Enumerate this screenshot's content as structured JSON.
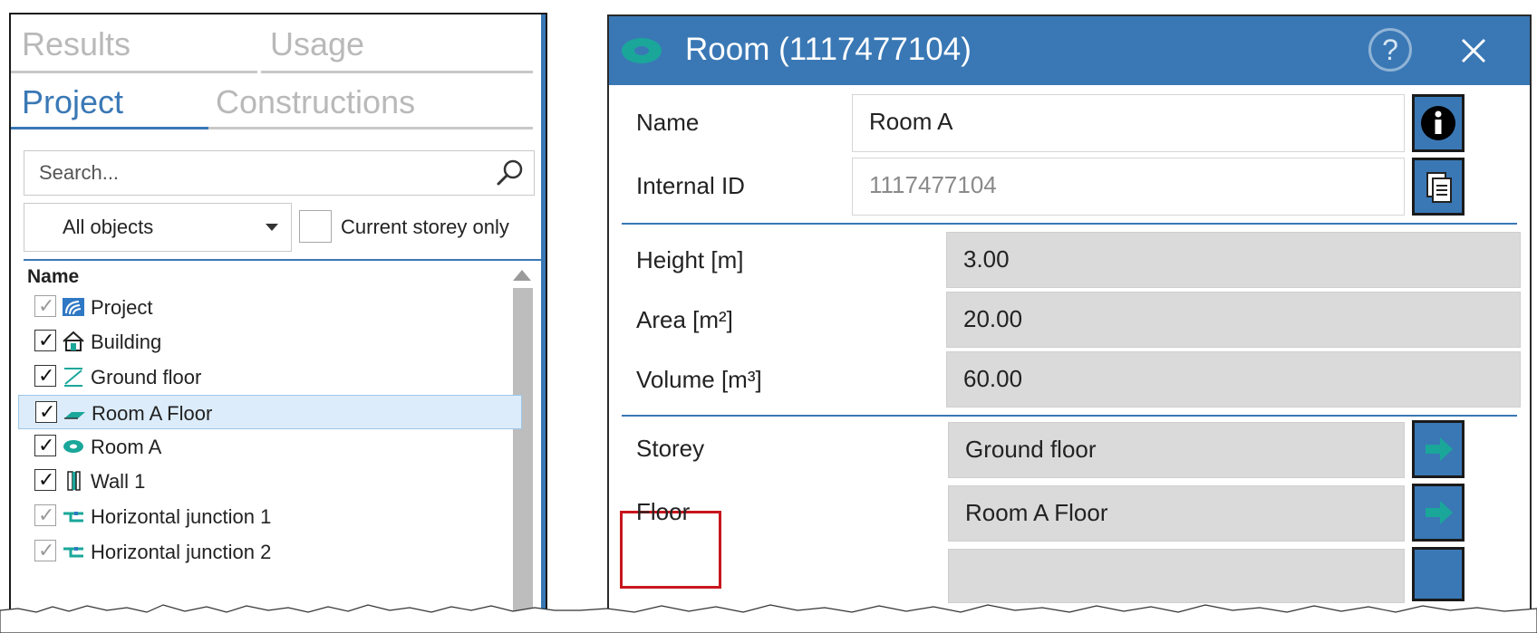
{
  "left_panel": {
    "tabs": {
      "results": "Results",
      "usage": "Usage",
      "project": "Project",
      "constructions": "Constructions"
    },
    "search": {
      "placeholder": "Search..."
    },
    "filter": {
      "selected": "All objects"
    },
    "storey_only_label": "Current storey only",
    "column_header": "Name",
    "tree": [
      {
        "label": "Project",
        "checked": true,
        "disabled": true,
        "icon": "project-icon"
      },
      {
        "label": "Building",
        "checked": true,
        "disabled": false,
        "icon": "building-icon"
      },
      {
        "label": "Ground floor",
        "checked": true,
        "disabled": false,
        "icon": "storey-icon"
      },
      {
        "label": "Room A Floor",
        "checked": true,
        "disabled": false,
        "icon": "floor-icon",
        "selected": true
      },
      {
        "label": "Room A",
        "checked": true,
        "disabled": false,
        "icon": "room-icon"
      },
      {
        "label": "Wall 1",
        "checked": true,
        "disabled": false,
        "icon": "wall-icon"
      },
      {
        "label": "Horizontal junction 1",
        "checked": true,
        "disabled": true,
        "icon": "junction-icon"
      },
      {
        "label": "Horizontal junction 2",
        "checked": true,
        "disabled": true,
        "icon": "junction-icon"
      }
    ]
  },
  "dialog": {
    "title": "Room (1117477104)",
    "help_symbol": "?",
    "fields": {
      "name": {
        "label": "Name",
        "value": "Room A"
      },
      "internal_id": {
        "label": "Internal ID",
        "value": "1117477104"
      },
      "height": {
        "label": "Height [m]",
        "value": "3.00"
      },
      "area": {
        "label": "Area [m²]",
        "value": "20.00"
      },
      "volume": {
        "label": "Volume [m³]",
        "value": "60.00"
      },
      "storey": {
        "label": "Storey",
        "value": "Ground floor"
      },
      "floor": {
        "label": "Floor",
        "value": "Room A Floor"
      }
    }
  },
  "colors": {
    "accent": "#3a78b5",
    "highlight_box": "#c8161d",
    "selection": "#dcecfa",
    "teal_icon": "#1aa79a",
    "readonly_field": "#dadada"
  }
}
